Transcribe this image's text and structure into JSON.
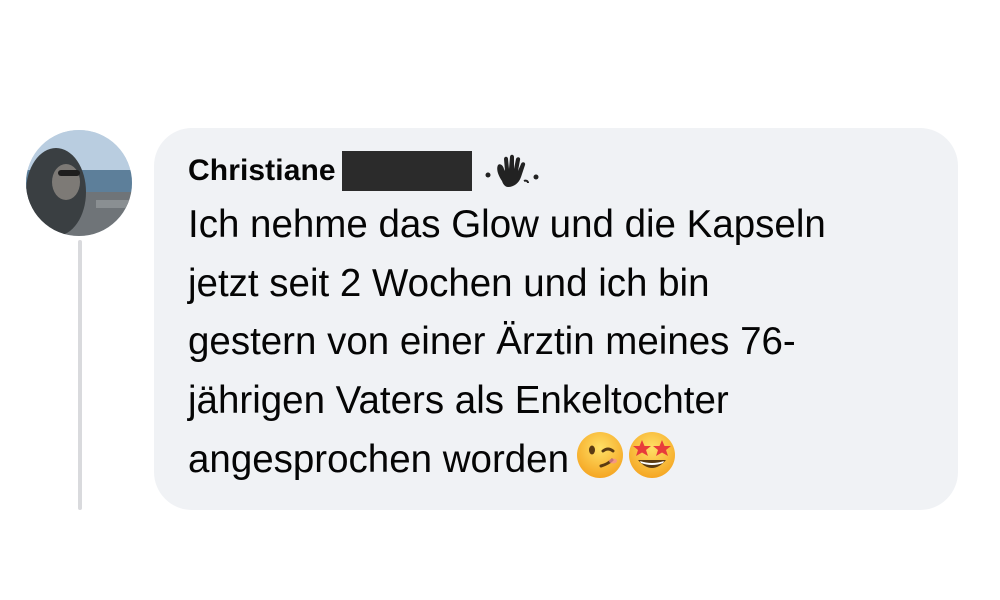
{
  "comment": {
    "author_name": "Christiane",
    "text": "Ich nehme das Glow und die Kapseln\njetzt seit 2 Wochen und ich bin\ngestern von einer Ärztin meines 76-\njährigen Vaters als Enkeltochter\nangesprochen worden",
    "badge_icon": "waving-hand-icon",
    "emojis": [
      "winking-face-icon",
      "star-struck-icon"
    ]
  },
  "colors": {
    "bubble_background": "#f0f2f5",
    "text": "#050505",
    "thread_line": "#d9dadd",
    "redaction": "#2b2b2b"
  }
}
